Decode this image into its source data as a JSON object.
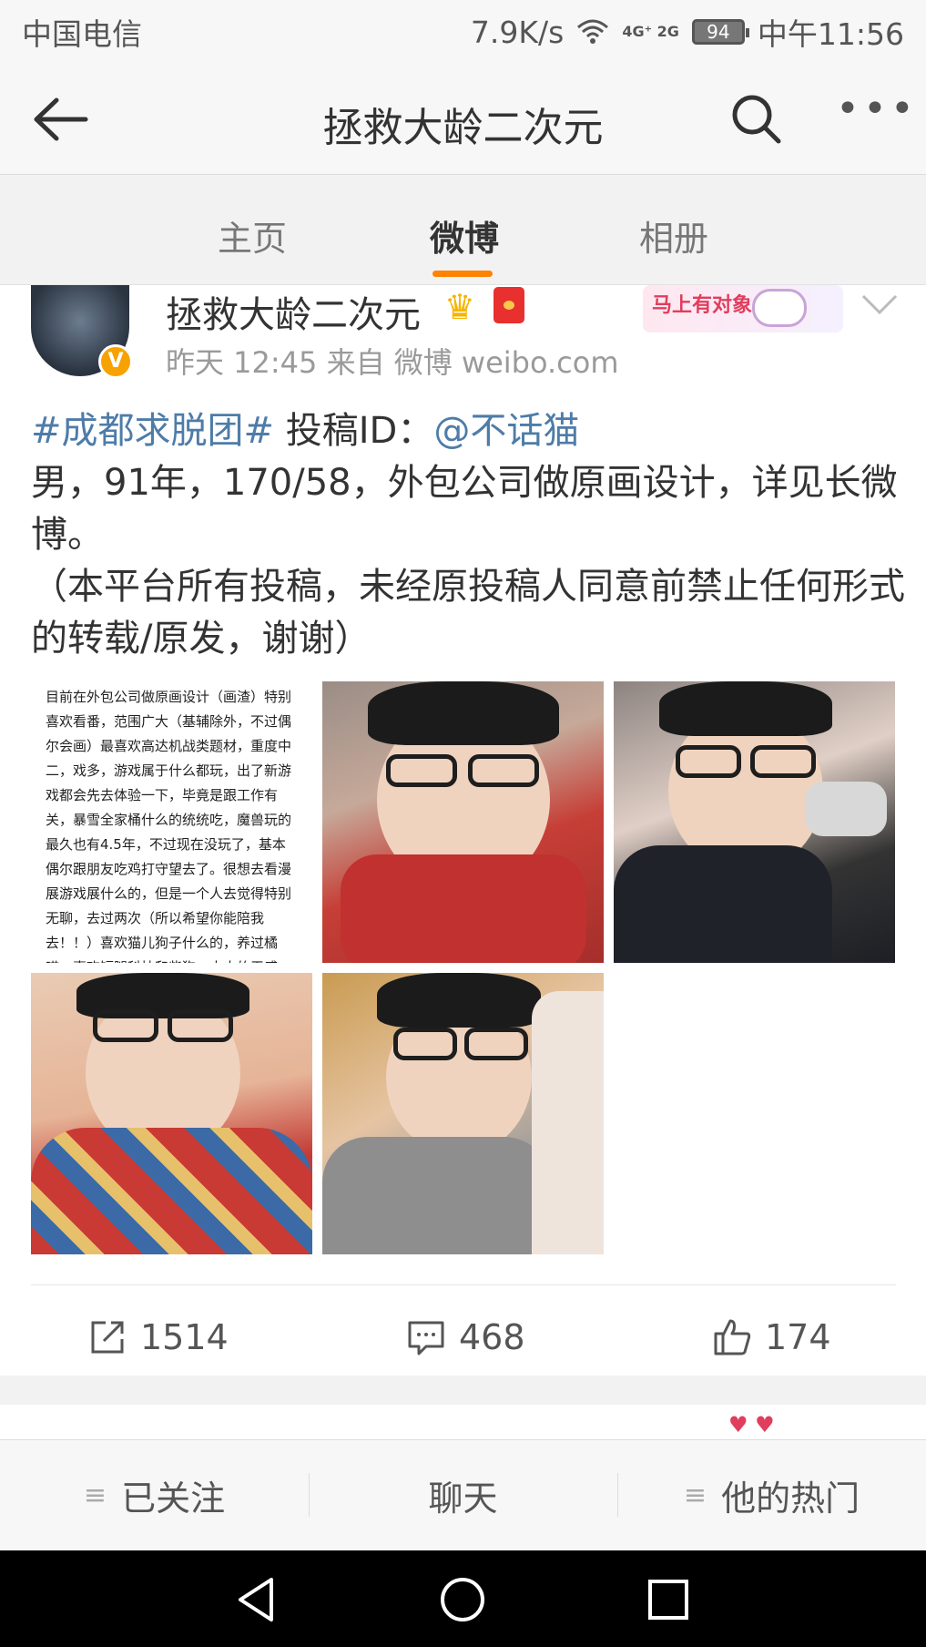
{
  "status_bar": {
    "carrier": "中国电信",
    "speed": "7.9K/s",
    "network": "4G⁺ 2G",
    "battery": "94",
    "time": "中午11:56"
  },
  "title_bar": {
    "title": "拯救大龄二次元",
    "back_icon": "arrow-left",
    "search_icon": "magnifier",
    "more_icon": "ellipsis"
  },
  "tabs": [
    {
      "label": "主页",
      "active": false
    },
    {
      "label": "微博",
      "active": true
    },
    {
      "label": "相册",
      "active": false
    }
  ],
  "accent_color": "#ff8200",
  "link_color": "#4e7ca8",
  "post": {
    "username": "拯救大龄二次元",
    "verified_badge": "V",
    "decoration_text": "马上有对象",
    "meta": "昨天 12:45  来自 微博 weibo.com",
    "hashtag": "#成都求脱团#",
    "submit_label": " 投稿ID：",
    "mention": "@不话猫",
    "body": "男，91年，170/58，外包公司做原画设计，详见长微博。",
    "notice": "（本平台所有投稿，未经原投稿人同意前禁止任何形式的转载/原发，谢谢）",
    "long_text": "目前在外包公司做原画设计（画渣）特别喜欢看番，范围广大（基辅除外，不过偶尔会画）最喜欢高达机战类题材，重度中二，戏多，游戏属于什么都玩，出了新游戏都会先去体验一下，毕竟是跟工作有关，暴雪全家桶什么的统统吃，魔兽玩的最久也有4.5年，不过现在没玩了，基本偶尔跟朋友吃鸡打守望去了。很想去看漫展游戏展什么的，但是一个人去觉得特别无聊，去过两次（所以希望你能陪我去！！）喜欢猫儿狗子什么的，养过橘喵，喜欢短腿科技和柴狗，太大的无感，对于对象要求不多，合得来就好（2333最好离我近点，虽然成都不大，太忙的时候"
  },
  "actions": {
    "repost": "1514",
    "comment": "468",
    "like": "174"
  },
  "bottom_bar": {
    "follow": "已关注",
    "chat": "聊天",
    "hot": "他的热门"
  }
}
